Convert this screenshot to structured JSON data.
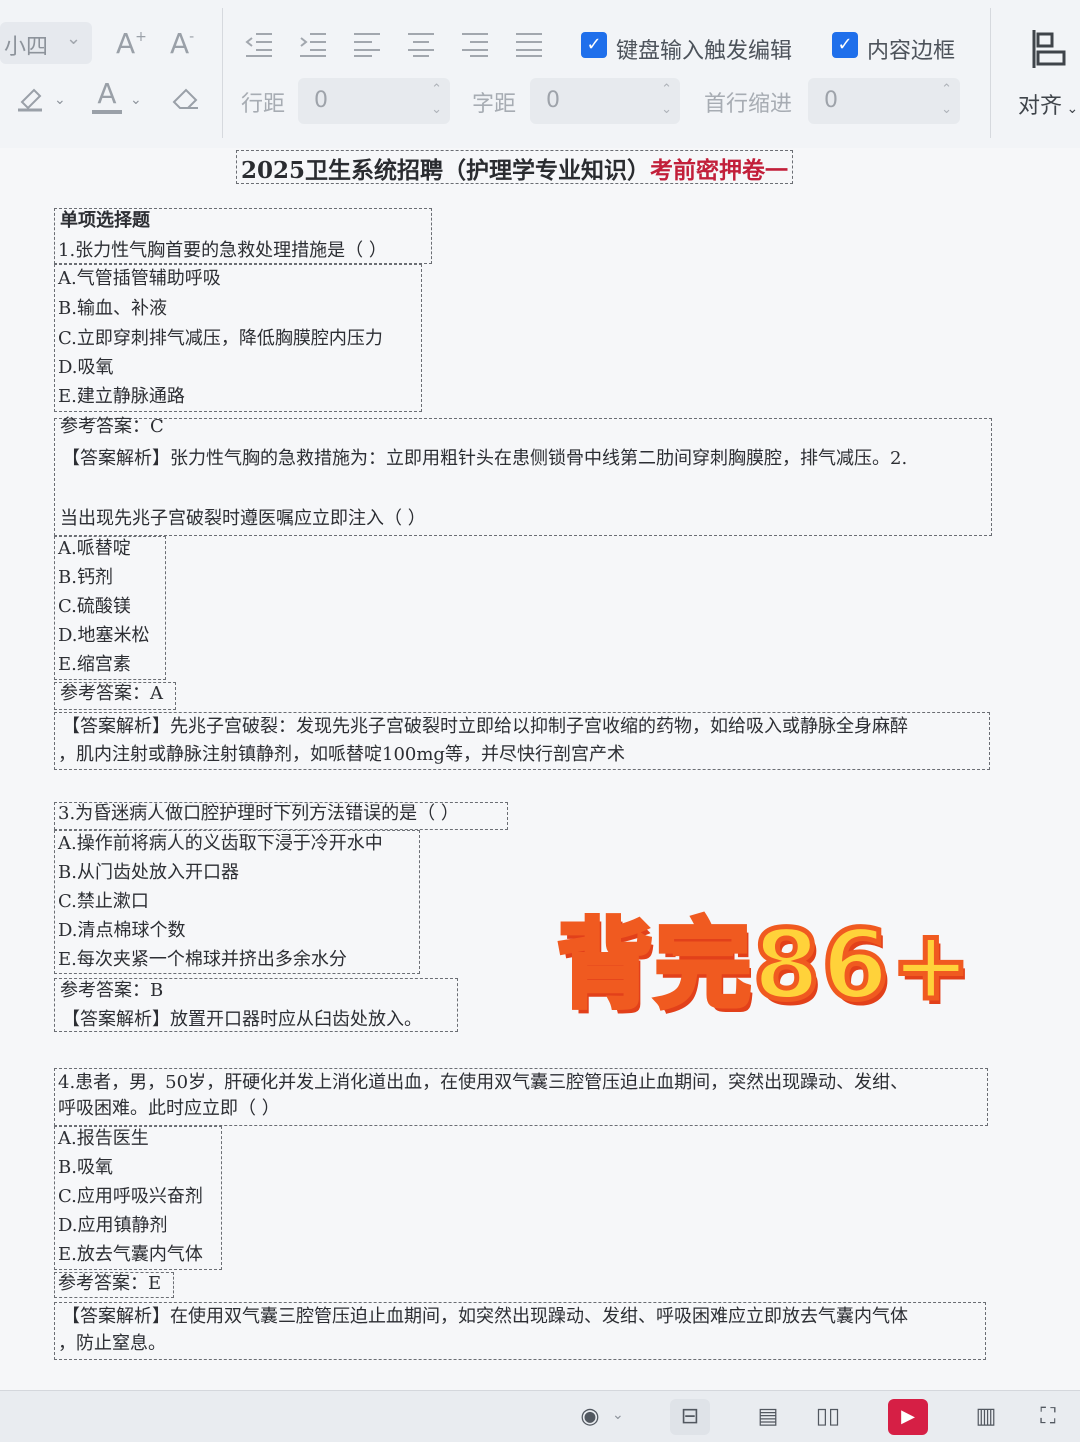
{
  "toolbar": {
    "font_size_value": "小四",
    "font_size_caret": "⌄",
    "font_grow_icon": "A+",
    "font_shrink_icon": "A-",
    "highlight_icon": "highlighter",
    "font_color_icon": "A",
    "eraser_icon": "eraser",
    "indent_icons": [
      "outdent-icon",
      "indent-icon",
      "align-left-icon",
      "align-center-icon",
      "align-right-icon",
      "justify-icon"
    ],
    "keyboard_edit_label": "键盘输入触发编辑",
    "keyboard_edit_checked": true,
    "content_border_label": "内容边框",
    "content_border_checked": true,
    "line_spacing_label": "行距",
    "line_spacing_value": "0",
    "char_spacing_label": "字距",
    "char_spacing_value": "0",
    "first_indent_label": "首行缩进",
    "first_indent_value": "0",
    "align_label": "对齐",
    "check_mark": "✓",
    "spin_arrows": "⌃⌄"
  },
  "document": {
    "title_black": "2025卫生系统招聘（护理学专业知识）",
    "title_red": "考前密押卷一",
    "section": "单项选择题",
    "q1": {
      "stem": "1.张力性气胸首要的急救处理措施是（ ）",
      "options": [
        "A.气管插管辅助呼吸",
        "B.输血、补液",
        "C.立即穿刺排气减压，降低胸膜腔内压力",
        "D.吸氧",
        "E.建立静脉通路"
      ],
      "answer": "参考答案：C",
      "analysis": "【答案解析】张力性气胸的急救措施为：立即用粗针头在患侧锁骨中线第二肋间穿刺胸膜腔，排气减压。2."
    },
    "q2": {
      "stem": "当出现先兆子宫破裂时遵医嘱应立即注入（ ）",
      "options": [
        "A.哌替啶",
        "B.钙剂",
        "C.硫酸镁",
        "D.地塞米松",
        "E.缩宫素"
      ],
      "answer": "参考答案：A",
      "analysis_line1": "【答案解析】先兆子宫破裂：发现先兆子宫破裂时立即给以抑制子宫收缩的药物，如给吸入或静脉全身麻醉",
      "analysis_line2": "，肌内注射或静脉注射镇静剂，如哌替啶100mg等，并尽快行剖宫产术"
    },
    "q3": {
      "stem": "3.为昏迷病人做口腔护理时下列方法错误的是（ ）",
      "options": [
        "A.操作前将病人的义齿取下浸于冷开水中",
        "B.从门齿处放入开口器",
        "C.禁止漱口",
        "D.清点棉球个数",
        "E.每次夹紧一个棉球并挤出多余水分"
      ],
      "answer": "参考答案：B",
      "analysis": "【答案解析】放置开口器时应从臼齿处放入。"
    },
    "q4": {
      "stem_line1": "4.患者，男，50岁，肝硬化并发上消化道出血，在使用双气囊三腔管压迫止血期间，突然出现躁动、发绀、",
      "stem_line2": "呼吸困难。此时应立即（ ）",
      "options": [
        "A.报告医生",
        "B.吸氧",
        "C.应用呼吸兴奋剂",
        "D.应用镇静剂",
        "E.放去气囊内气体"
      ],
      "answer": "参考答案：E",
      "analysis_line1": "【答案解析】在使用双气囊三腔管压迫止血期间，如突然出现躁动、发绀、呼吸困难应立即放去气囊内气体",
      "analysis_line2": "，防止窒息。"
    }
  },
  "overlay": {
    "text": "背完86+"
  },
  "statusbar": {
    "eye_icon": "◉",
    "eye_caret": "⌄",
    "fit_page_icon": "⊟",
    "single_page_icon": "▤",
    "double_page_icon": "▯▯",
    "present_icon": "▶",
    "read_mode_icon": "▥",
    "fullscreen_icon": "⛶"
  },
  "colors": {
    "accent_blue": "#1f6feb",
    "title_red": "#c21f3a",
    "sticker_fill": "#ffd23a",
    "sticker_stroke": "#f05a20",
    "present_red": "#d61f45"
  }
}
